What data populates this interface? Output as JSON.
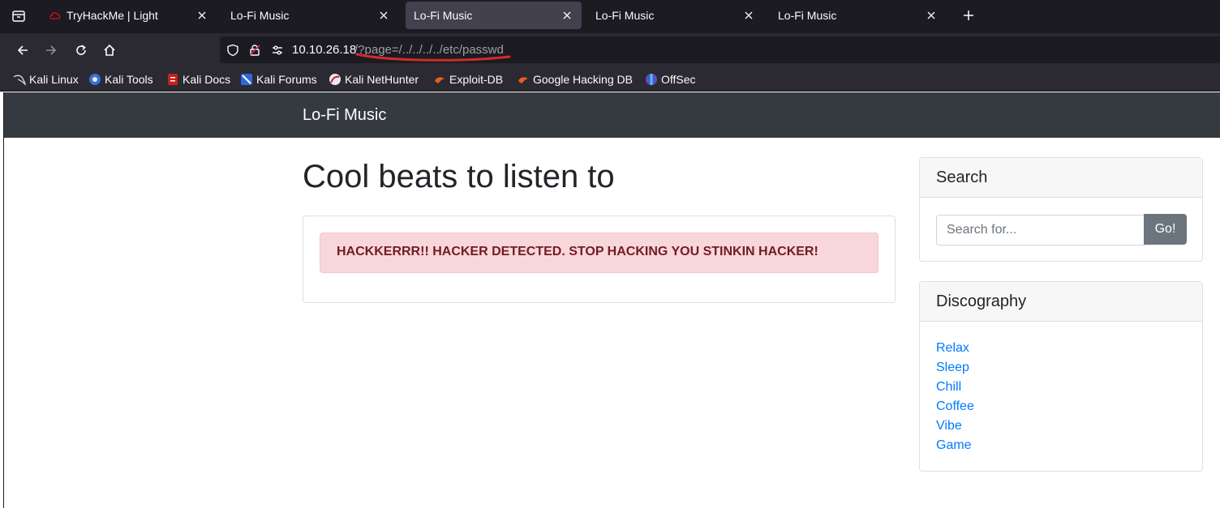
{
  "browser": {
    "tabs": [
      {
        "title": "TryHackMe | Light",
        "active": false,
        "icon": "thm-cloud-icon"
      },
      {
        "title": "Lo-Fi Music",
        "active": false,
        "icon": ""
      },
      {
        "title": "Lo-Fi Music",
        "active": true,
        "icon": ""
      },
      {
        "title": "Lo-Fi Music",
        "active": false,
        "icon": ""
      },
      {
        "title": "Lo-Fi Music",
        "active": false,
        "icon": ""
      }
    ],
    "url": {
      "host": "10.10.26.18",
      "path": "/?page=/../../../../etc/passwd"
    },
    "bookmarks": [
      {
        "label": "Kali Linux",
        "icon": "kali-dragon-icon"
      },
      {
        "label": "Kali Tools",
        "icon": "kali-tools-icon"
      },
      {
        "label": "Kali Docs",
        "icon": "kali-docs-icon"
      },
      {
        "label": "Kali Forums",
        "icon": "kali-forums-icon"
      },
      {
        "label": "Kali NetHunter",
        "icon": "nethunter-icon"
      },
      {
        "label": "Exploit-DB",
        "icon": "exploit-db-icon"
      },
      {
        "label": "Google Hacking DB",
        "icon": "ghdb-icon"
      },
      {
        "label": "OffSec",
        "icon": "offsec-icon"
      }
    ],
    "colors": {
      "tabbar": "#1c1b22",
      "toolbar": "#2b2a33",
      "annotation_underline": "#d42a2a"
    }
  },
  "site": {
    "brand": "Lo-Fi Music",
    "heading": "Cool beats to listen to",
    "alert": "HACKKERRR!! HACKER DETECTED. STOP HACKING YOU STINKIN HACKER!",
    "search": {
      "title": "Search",
      "placeholder": "Search for...",
      "button": "Go!"
    },
    "discography": {
      "title": "Discography",
      "items": [
        "Relax",
        "Sleep",
        "Chill",
        "Coffee",
        "Vibe",
        "Game"
      ]
    },
    "colors": {
      "navbar": "#343a40",
      "alert_bg": "#f8d7da",
      "alert_text": "#721c24",
      "link": "#007bff",
      "button": "#6c757d"
    }
  }
}
